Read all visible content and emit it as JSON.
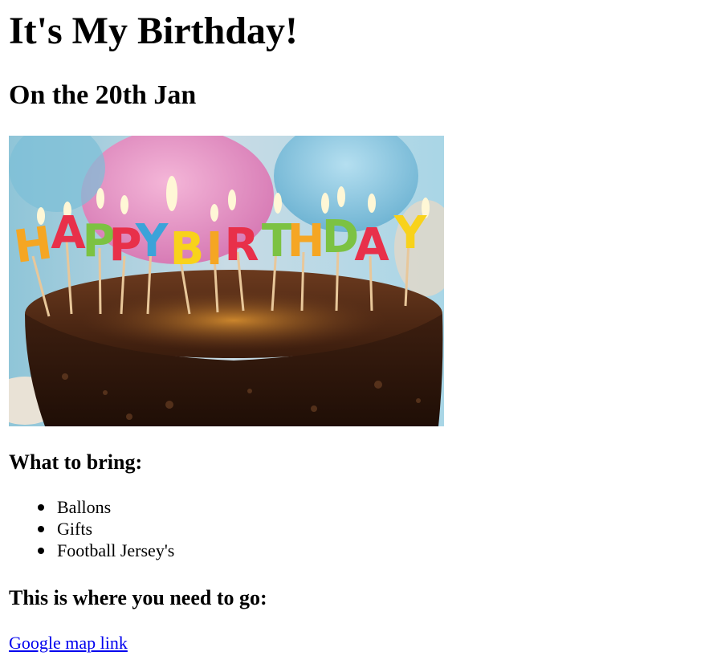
{
  "page": {
    "title": "It's My Birthday!",
    "subtitle": "On the 20th Jan",
    "image": {
      "name": "birthday-cake-image",
      "candle_letters": [
        "H",
        "A",
        "P",
        "P",
        "Y",
        "B",
        "I",
        "R",
        "T",
        "H",
        "D",
        "A",
        "Y"
      ]
    },
    "bring": {
      "heading": "What to bring:",
      "items": [
        "Ballons",
        "Gifts",
        "Football Jersey's"
      ]
    },
    "location": {
      "heading": "This is where you need to go:",
      "link_text": "Google map link"
    }
  },
  "colors": {
    "link": "#0000ee",
    "text": "#000000",
    "background": "#ffffff"
  }
}
